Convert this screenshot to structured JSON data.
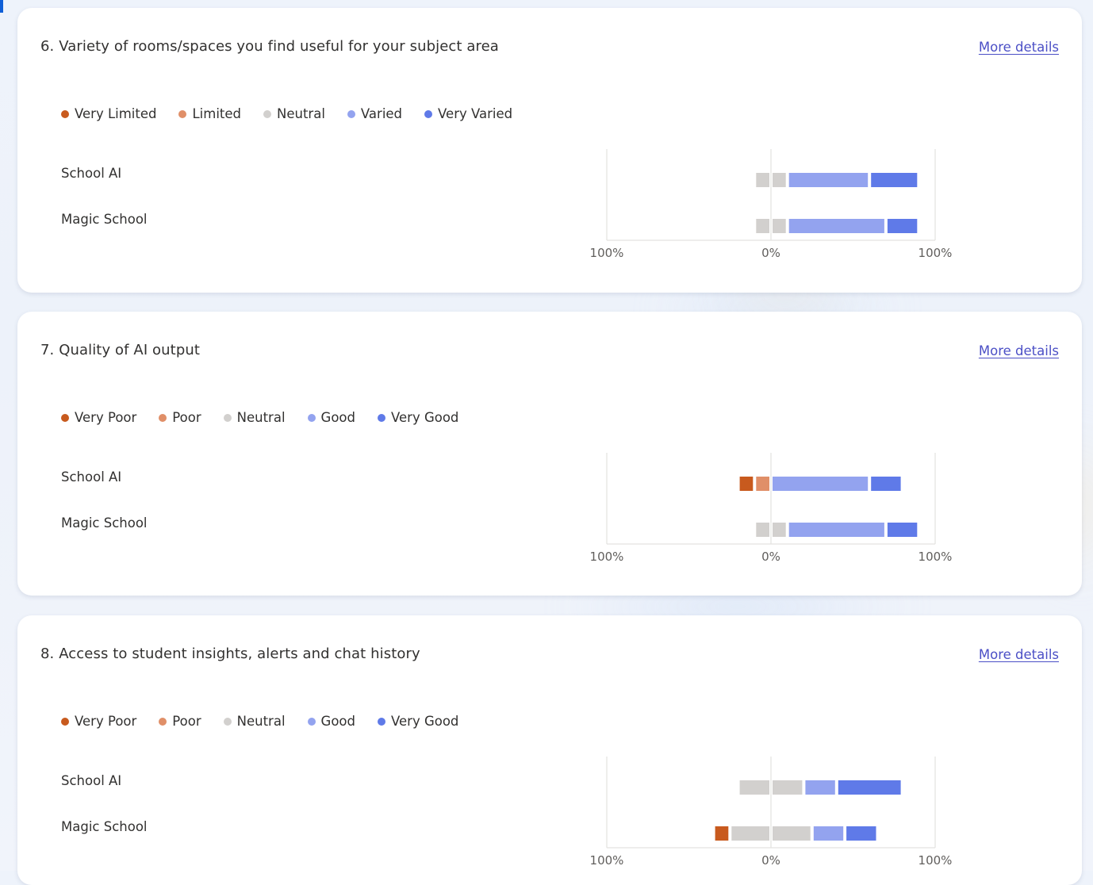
{
  "colors": {
    "very_negative": "#c85a1e",
    "negative": "#e08f68",
    "neutral": "#d2d0ce",
    "positive": "#93a3ef",
    "very_positive": "#5f7ae8"
  },
  "questions": [
    {
      "title": "6. Variety of rooms/spaces you find useful for your subject area",
      "more_details": "More details",
      "legend": [
        "Very Limited",
        "Limited",
        "Neutral",
        "Varied",
        "Very Varied"
      ],
      "rows": [
        "School AI",
        "Magic School"
      ],
      "axis_ticks": [
        "100%",
        "0%",
        "100%"
      ]
    },
    {
      "title": "7. Quality of AI output",
      "more_details": "More details",
      "legend": [
        "Very Poor",
        "Poor",
        "Neutral",
        "Good",
        "Very Good"
      ],
      "rows": [
        "School AI",
        "Magic School"
      ],
      "axis_ticks": [
        "100%",
        "0%",
        "100%"
      ]
    },
    {
      "title": "8. Access to student insights, alerts and chat history",
      "more_details": "More details",
      "legend": [
        "Very Poor",
        "Poor",
        "Neutral",
        "Good",
        "Very Good"
      ],
      "rows": [
        "School AI",
        "Magic School"
      ],
      "axis_ticks": [
        "100%",
        "0%",
        "100%"
      ]
    }
  ],
  "chart_data": [
    {
      "type": "bar",
      "orientation": "horizontal-diverging",
      "title": "6. Variety of rooms/spaces you find useful for your subject area",
      "categories": [
        "School AI",
        "Magic School"
      ],
      "xlim": [
        -100,
        100
      ],
      "series": [
        {
          "name": "Very Limited",
          "values": [
            0,
            0
          ]
        },
        {
          "name": "Limited",
          "values": [
            0,
            0
          ]
        },
        {
          "name": "Neutral",
          "values": [
            20,
            20
          ]
        },
        {
          "name": "Varied",
          "values": [
            50,
            60
          ]
        },
        {
          "name": "Very Varied",
          "values": [
            30,
            20
          ]
        }
      ]
    },
    {
      "type": "bar",
      "orientation": "horizontal-diverging",
      "title": "7. Quality of AI output",
      "categories": [
        "School AI",
        "Magic School"
      ],
      "xlim": [
        -100,
        100
      ],
      "series": [
        {
          "name": "Very Poor",
          "values": [
            10,
            0
          ]
        },
        {
          "name": "Poor",
          "values": [
            10,
            0
          ]
        },
        {
          "name": "Neutral",
          "values": [
            0,
            20
          ]
        },
        {
          "name": "Good",
          "values": [
            60,
            60
          ]
        },
        {
          "name": "Very Good",
          "values": [
            20,
            20
          ]
        }
      ]
    },
    {
      "type": "bar",
      "orientation": "horizontal-diverging",
      "title": "8. Access to student insights, alerts and chat history",
      "categories": [
        "School AI",
        "Magic School"
      ],
      "xlim": [
        -100,
        100
      ],
      "series": [
        {
          "name": "Very Poor",
          "values": [
            0,
            10
          ]
        },
        {
          "name": "Poor",
          "values": [
            0,
            0
          ]
        },
        {
          "name": "Neutral",
          "values": [
            40,
            50
          ]
        },
        {
          "name": "Good",
          "values": [
            20,
            20
          ]
        },
        {
          "name": "Very Good",
          "values": [
            40,
            20
          ]
        }
      ]
    }
  ]
}
